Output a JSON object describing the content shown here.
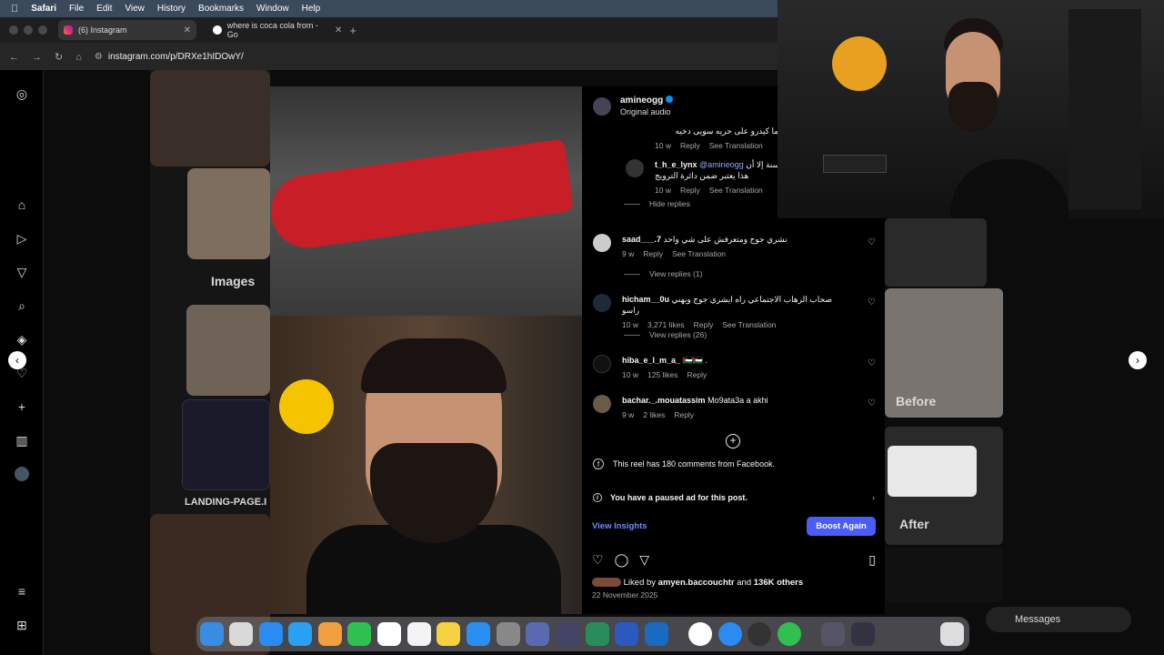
{
  "menubar": {
    "apple": "",
    "app": "Safari",
    "items": [
      "File",
      "Edit",
      "View",
      "History",
      "Bookmarks",
      "Window",
      "Help"
    ]
  },
  "tabs": [
    {
      "label": "(6) Instagram",
      "active": true
    },
    {
      "label": "where is coca cola from - Go",
      "active": false
    }
  ],
  "toolbar": {
    "url": "instagram.com/p/DRXe1hIDOwY/"
  },
  "bg": {
    "images_word": "Images",
    "landing_word": "LANDING-PAGE.I",
    "before_word": "Before",
    "after_word": "After"
  },
  "post": {
    "username": "amineogg",
    "audio": "Original audio",
    "comments": [
      {
        "text": "اشهر و إيما كيدرو على حريه سويى دخيه",
        "time": "10 w",
        "reply": "Reply",
        "translate": "See Translation"
      },
      {
        "user": "t_h_e_lynx",
        "mention": "@amineogg",
        "text": "النية ديالك حسنة إلا أن هذا يعتبر ضمن دائرة الترويج",
        "time": "10 w",
        "reply": "Reply",
        "translate": "See Translation"
      },
      {
        "user": "saad___.7",
        "text": "نشري جوج ومتعرفش على شي واحد",
        "time": "9 w",
        "reply": "Reply",
        "translate": "See Translation"
      },
      {
        "user": "hicham__0u",
        "text": "صحاب الرهاب الاجتماعي راه ايشري جوج ويهني راسو",
        "time": "10 w",
        "likes": "3,271 likes",
        "reply": "Reply",
        "translate": "See Translation"
      },
      {
        "user": "hiba_e_l_m_a_",
        "text": "🇵🇸🇵🇸 .",
        "time": "10 w",
        "likes": "125 likes",
        "reply": "Reply"
      },
      {
        "user": "bachar._.mouatassim",
        "text": "Mo9ata3a a akhi",
        "time": "9 w",
        "likes": "2 likes",
        "reply": "Reply"
      }
    ],
    "hide_replies": "Hide replies",
    "view_replies_1": "View replies (1)",
    "view_replies_26": "View replies (26)",
    "fb_comments": "This reel has 180 comments from Facebook.",
    "paused_ad": "You have a paused ad for this post.",
    "view_insights": "View Insights",
    "boost_again": "Boost Again",
    "liked_prefix": "Liked by",
    "liked_user": "amyen.baccouchtr",
    "liked_and": "and",
    "liked_others": "136K others",
    "date": "22 November 2025"
  },
  "messages": {
    "label": "Messages"
  },
  "colors": {
    "accent": "#4a5df9",
    "link": "#6c8cff",
    "verified": "#0095f6"
  }
}
